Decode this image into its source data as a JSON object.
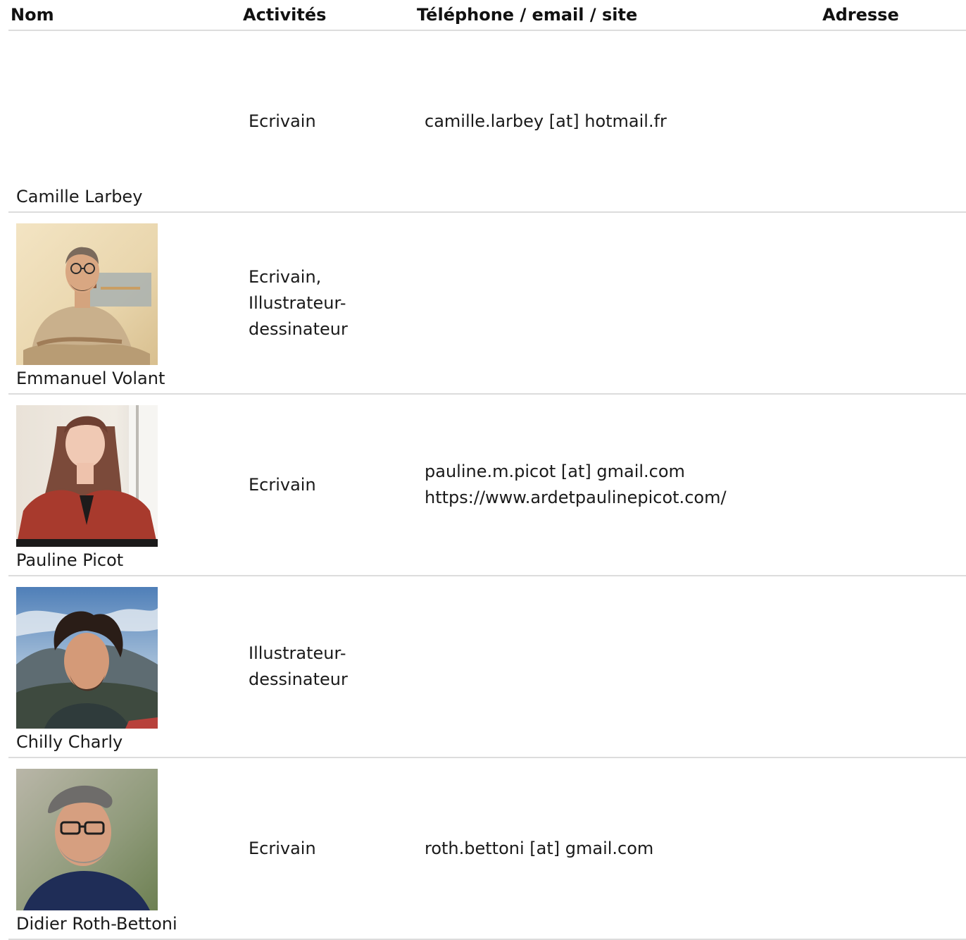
{
  "columns": {
    "name": "Nom",
    "activities": "Activités",
    "contact": "Téléphone / email / site",
    "address": "Adresse"
  },
  "rows": [
    {
      "name": "Camille Larbey",
      "activities": [
        "Ecrivain"
      ],
      "contact": [
        "camille.larbey [at] hotmail.fr"
      ],
      "address": "",
      "photo": null
    },
    {
      "name": "Emmanuel Volant",
      "activities": [
        "Ecrivain,",
        "Illustrateur-",
        "dessinateur"
      ],
      "contact": [],
      "address": "",
      "photo": "portrait-man-glasses-crossed-arms"
    },
    {
      "name": "Pauline Picot",
      "activities": [
        "Ecrivain"
      ],
      "contact": [
        "pauline.m.picot [at] gmail.com",
        "https://www.ardetpaulinepicot.com/"
      ],
      "address": "",
      "photo": "portrait-woman-red-blouse"
    },
    {
      "name": "Chilly Charly",
      "activities": [
        "Illustrateur-",
        "dessinateur"
      ],
      "contact": [],
      "address": "",
      "photo": "portrait-man-curly-hair-sky"
    },
    {
      "name": "Didier Roth-Bettoni",
      "activities": [
        "Ecrivain"
      ],
      "contact": [
        "roth.bettoni [at] gmail.com"
      ],
      "address": "",
      "photo": "portrait-man-cap-glasses"
    }
  ]
}
